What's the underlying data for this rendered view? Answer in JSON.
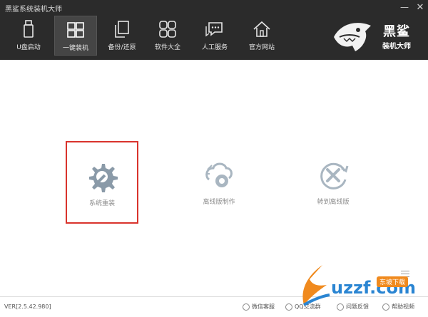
{
  "app": {
    "title": "黑鲨系统装机大师"
  },
  "nav": {
    "items": [
      {
        "label": "U盘启动",
        "icon": "usb-drive-icon"
      },
      {
        "label": "一键装机",
        "icon": "windows-icon",
        "active": true
      },
      {
        "label": "备份/还原",
        "icon": "backup-icon"
      },
      {
        "label": "软件大全",
        "icon": "apps-grid-icon"
      },
      {
        "label": "人工服务",
        "icon": "chat-icon"
      },
      {
        "label": "官方网站",
        "icon": "home-icon"
      }
    ]
  },
  "logo": {
    "text": "黑鲨",
    "sub": "装机大师",
    "icon": "shark-logo-icon"
  },
  "options": [
    {
      "label": "系统重装",
      "icon": "gear-wrench-icon",
      "selected": true
    },
    {
      "label": "离线版制作",
      "icon": "offline-gear-icon"
    },
    {
      "label": "转到离线版",
      "icon": "tools-refresh-icon"
    }
  ],
  "status": {
    "version": "VER[2.5.42.980]",
    "links": [
      {
        "label": "微信客服",
        "icon": "wechat-icon"
      },
      {
        "label": "QQ交流群",
        "icon": "qq-icon"
      },
      {
        "label": "问题反馈",
        "icon": "feedback-icon"
      },
      {
        "label": "帮助视频",
        "icon": "help-video-icon"
      }
    ]
  },
  "watermark": {
    "text": "uzzf.com",
    "badge": "东坡下载"
  },
  "colors": {
    "topbar": "#2b2b2b",
    "accent_red": "#d9332c",
    "icon_gray": "#8a9aa8"
  }
}
